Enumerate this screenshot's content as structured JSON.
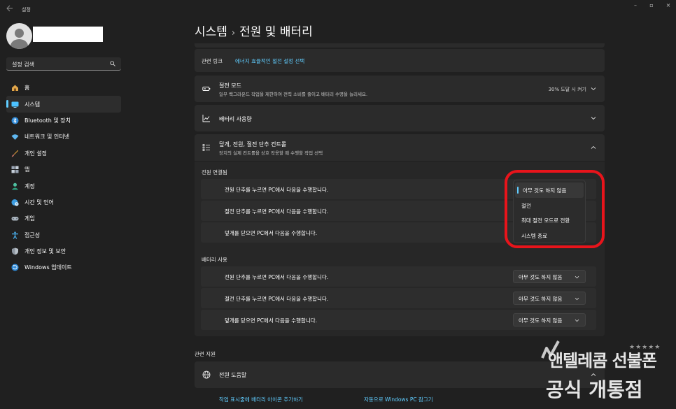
{
  "app": {
    "title": "설정"
  },
  "search": {
    "placeholder": "설정 검색"
  },
  "sidebar": {
    "items": [
      {
        "label": "홈"
      },
      {
        "label": "시스템"
      },
      {
        "label": "Bluetooth 및 장치"
      },
      {
        "label": "네트워크 및 인터넷"
      },
      {
        "label": "개인 설정"
      },
      {
        "label": "앱"
      },
      {
        "label": "계정"
      },
      {
        "label": "시간 및 언어"
      },
      {
        "label": "게임"
      },
      {
        "label": "접근성"
      },
      {
        "label": "개인 정보 및 보안"
      },
      {
        "label": "Windows 업데이트"
      }
    ]
  },
  "breadcrumb": {
    "parent": "시스템",
    "separator": "›",
    "current": "전원 및 배터리"
  },
  "related_links": {
    "label": "관련 링크",
    "link": "에너지 효율적인 절전 설정 선택"
  },
  "sleep": {
    "title": "절전 모드",
    "subtitle": "일부 백그라운드 작업을 제한하여 전력 소비를 줄이고 배터리 수명을 늘리세요.",
    "value": "30% 도달 시 켜기"
  },
  "battery_usage": {
    "title": "배터리 사용량"
  },
  "lid": {
    "title": "덮개, 전원, 절전 단추 컨트롤",
    "subtitle": "장치의 실제 컨트롤을 상호 작용할 때 수행할 작업 선택",
    "plugged_in": {
      "heading": "전원 연결됨",
      "rows": [
        {
          "label": "전원 단추를 누르면 PC에서 다음을 수행합니다."
        },
        {
          "label": "절전 단추를 누르면 PC에서 다음을 수행합니다."
        },
        {
          "label": "덮개를 닫으면 PC에서 다음을 수행합니다."
        }
      ]
    },
    "on_battery": {
      "heading": "배터리 사용",
      "rows": [
        {
          "label": "전원 단추를 누르면 PC에서 다음을 수행합니다.",
          "value": "아무 것도 하지 않음"
        },
        {
          "label": "절전 단추를 누르면 PC에서 다음을 수행합니다.",
          "value": "아무 것도 하지 않음"
        },
        {
          "label": "덮개를 닫으면 PC에서 다음을 수행합니다.",
          "value": "아무 것도 하지 않음"
        }
      ]
    }
  },
  "dropdown_menu": {
    "options": [
      "아무 것도 하지 않음",
      "절전",
      "최대 절전 모드로 전환",
      "시스템 종료"
    ],
    "selected_index": 0
  },
  "related_support": {
    "heading": "관련 지원",
    "help_title": "전원 도움말",
    "links": [
      "작업 표시줄에 배터리 아이콘 추가하기",
      "자동으로 Windows PC 잠그기"
    ]
  },
  "watermark": {
    "line1": "앤텔레콤 선불폰",
    "line2": "공식 개통점",
    "stars": "★★★★★"
  },
  "colors": {
    "accent": "#60cdff",
    "highlight": "#e8141b",
    "background": "#202020",
    "card": "#2b2b2b"
  }
}
